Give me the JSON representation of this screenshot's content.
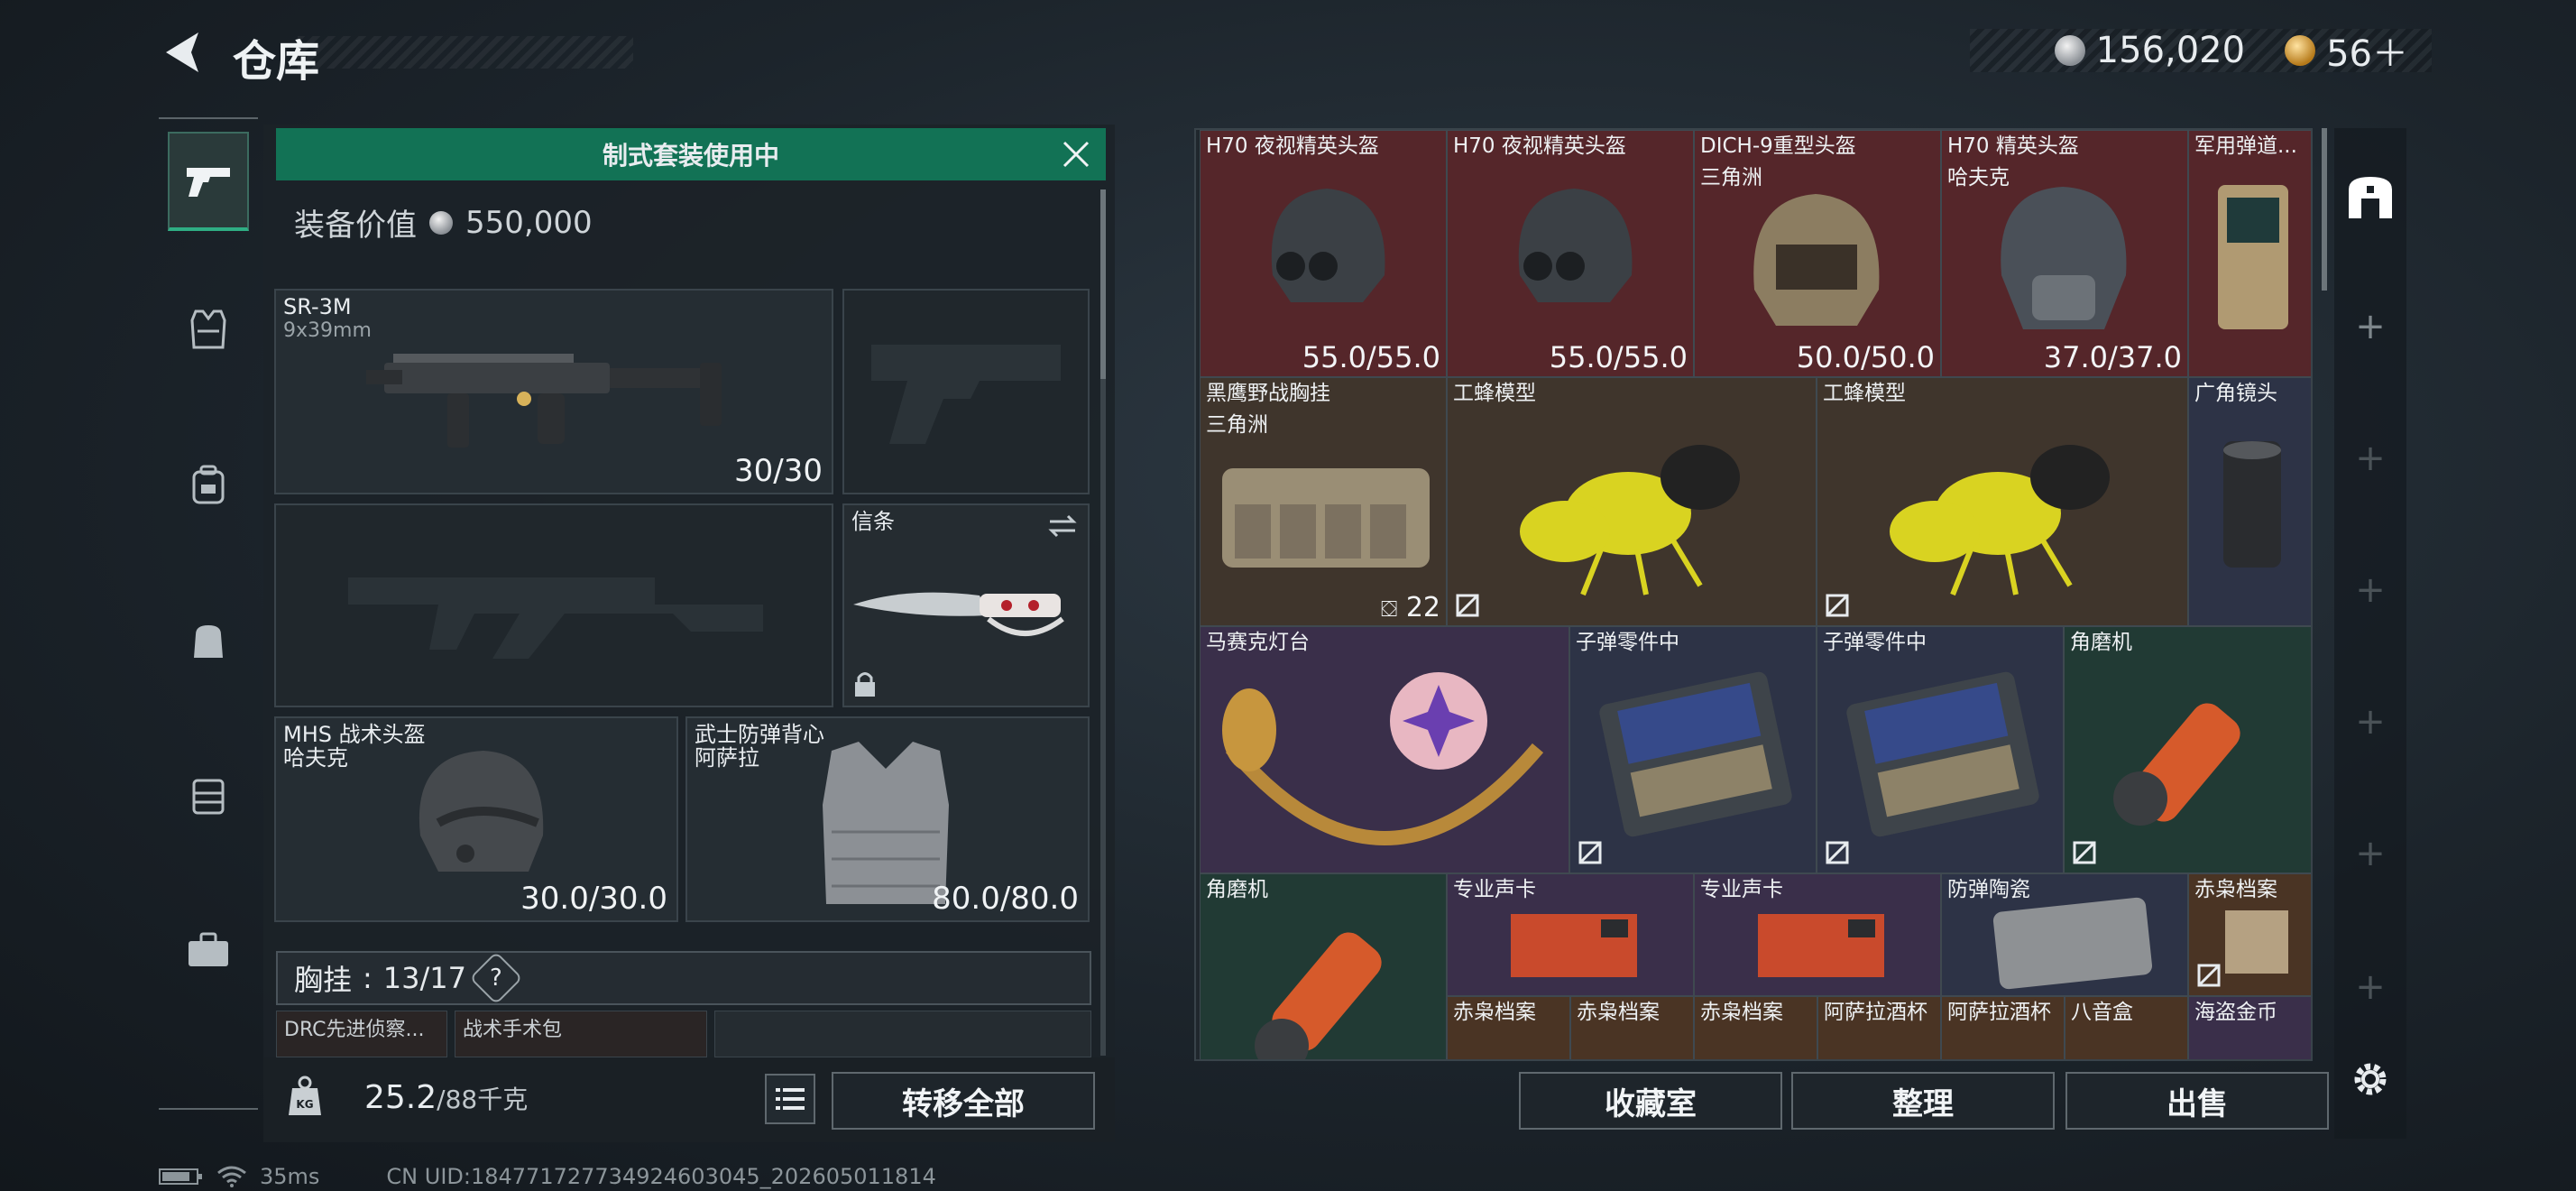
{
  "header": {
    "title": "仓库"
  },
  "currency": {
    "coins": "156,020",
    "tickets": "56＋"
  },
  "loadout": {
    "banner": "制式套装使用中",
    "value_label": "装备价值",
    "value": "550,000",
    "primary": {
      "name": "SR-3M",
      "caliber": "9x39mm",
      "ammo": "30/30"
    },
    "melee": {
      "name": "信条"
    },
    "helmet": {
      "name": "MHS 战术头盔",
      "map": "哈夫克",
      "durability": "30.0/30.0"
    },
    "armor": {
      "name": "武士防弹背心",
      "map": "阿萨拉",
      "durability": "80.0/80.0"
    },
    "rig": {
      "label": "胸挂",
      "capacity": "13/17",
      "help": "?"
    },
    "rig_items": [
      "DRC先进侦察...",
      "战术手术包"
    ],
    "weight": "25.2",
    "weight_max": "/88千克",
    "transfer_all": "转移全部"
  },
  "stash": {
    "rows": [
      [
        {
          "name": "H70 夜视精英头盔",
          "sub": "",
          "dur": "55.0/55.0"
        },
        {
          "name": "H70 夜视精英头盔",
          "sub": "",
          "dur": "55.0/55.0"
        },
        {
          "name": "DICH-9重型头盔",
          "sub": "三角洲",
          "dur": "50.0/50.0"
        },
        {
          "name": "H70 精英头盔",
          "sub": "哈夫克",
          "dur": "37.0/37.0"
        },
        {
          "name": "军用弹道...",
          "sub": "",
          "dur": ""
        }
      ],
      [
        {
          "name": "黑鹰野战胸挂",
          "sub": "三角洲",
          "count": "22"
        },
        {
          "name": "工蜂模型"
        },
        {
          "name": "工蜂模型"
        },
        {
          "name": "广角镜头"
        }
      ],
      [
        {
          "name": "马赛克灯台"
        },
        {
          "name": "子弹零件中"
        },
        {
          "name": "子弹零件中"
        },
        {
          "name": "角磨机"
        }
      ],
      [
        {
          "name": "角磨机"
        },
        {
          "name": "专业声卡"
        },
        {
          "name": "专业声卡"
        },
        {
          "name": "防弹陶瓷"
        },
        {
          "name": "赤枭档案"
        }
      ],
      [
        {
          "name": "赤枭档案"
        },
        {
          "name": "赤枭档案"
        },
        {
          "name": "赤枭档案"
        },
        {
          "name": "阿萨拉酒杯"
        },
        {
          "name": "阿萨拉酒杯"
        },
        {
          "name": "八音盒"
        },
        {
          "name": "海盗金币"
        }
      ]
    ]
  },
  "actions": {
    "collection": "收藏室",
    "organize": "整理",
    "sell": "出售"
  },
  "footer": {
    "ping": "35ms",
    "uid": "CN UID:1847717277349246030​45_202605011814"
  }
}
